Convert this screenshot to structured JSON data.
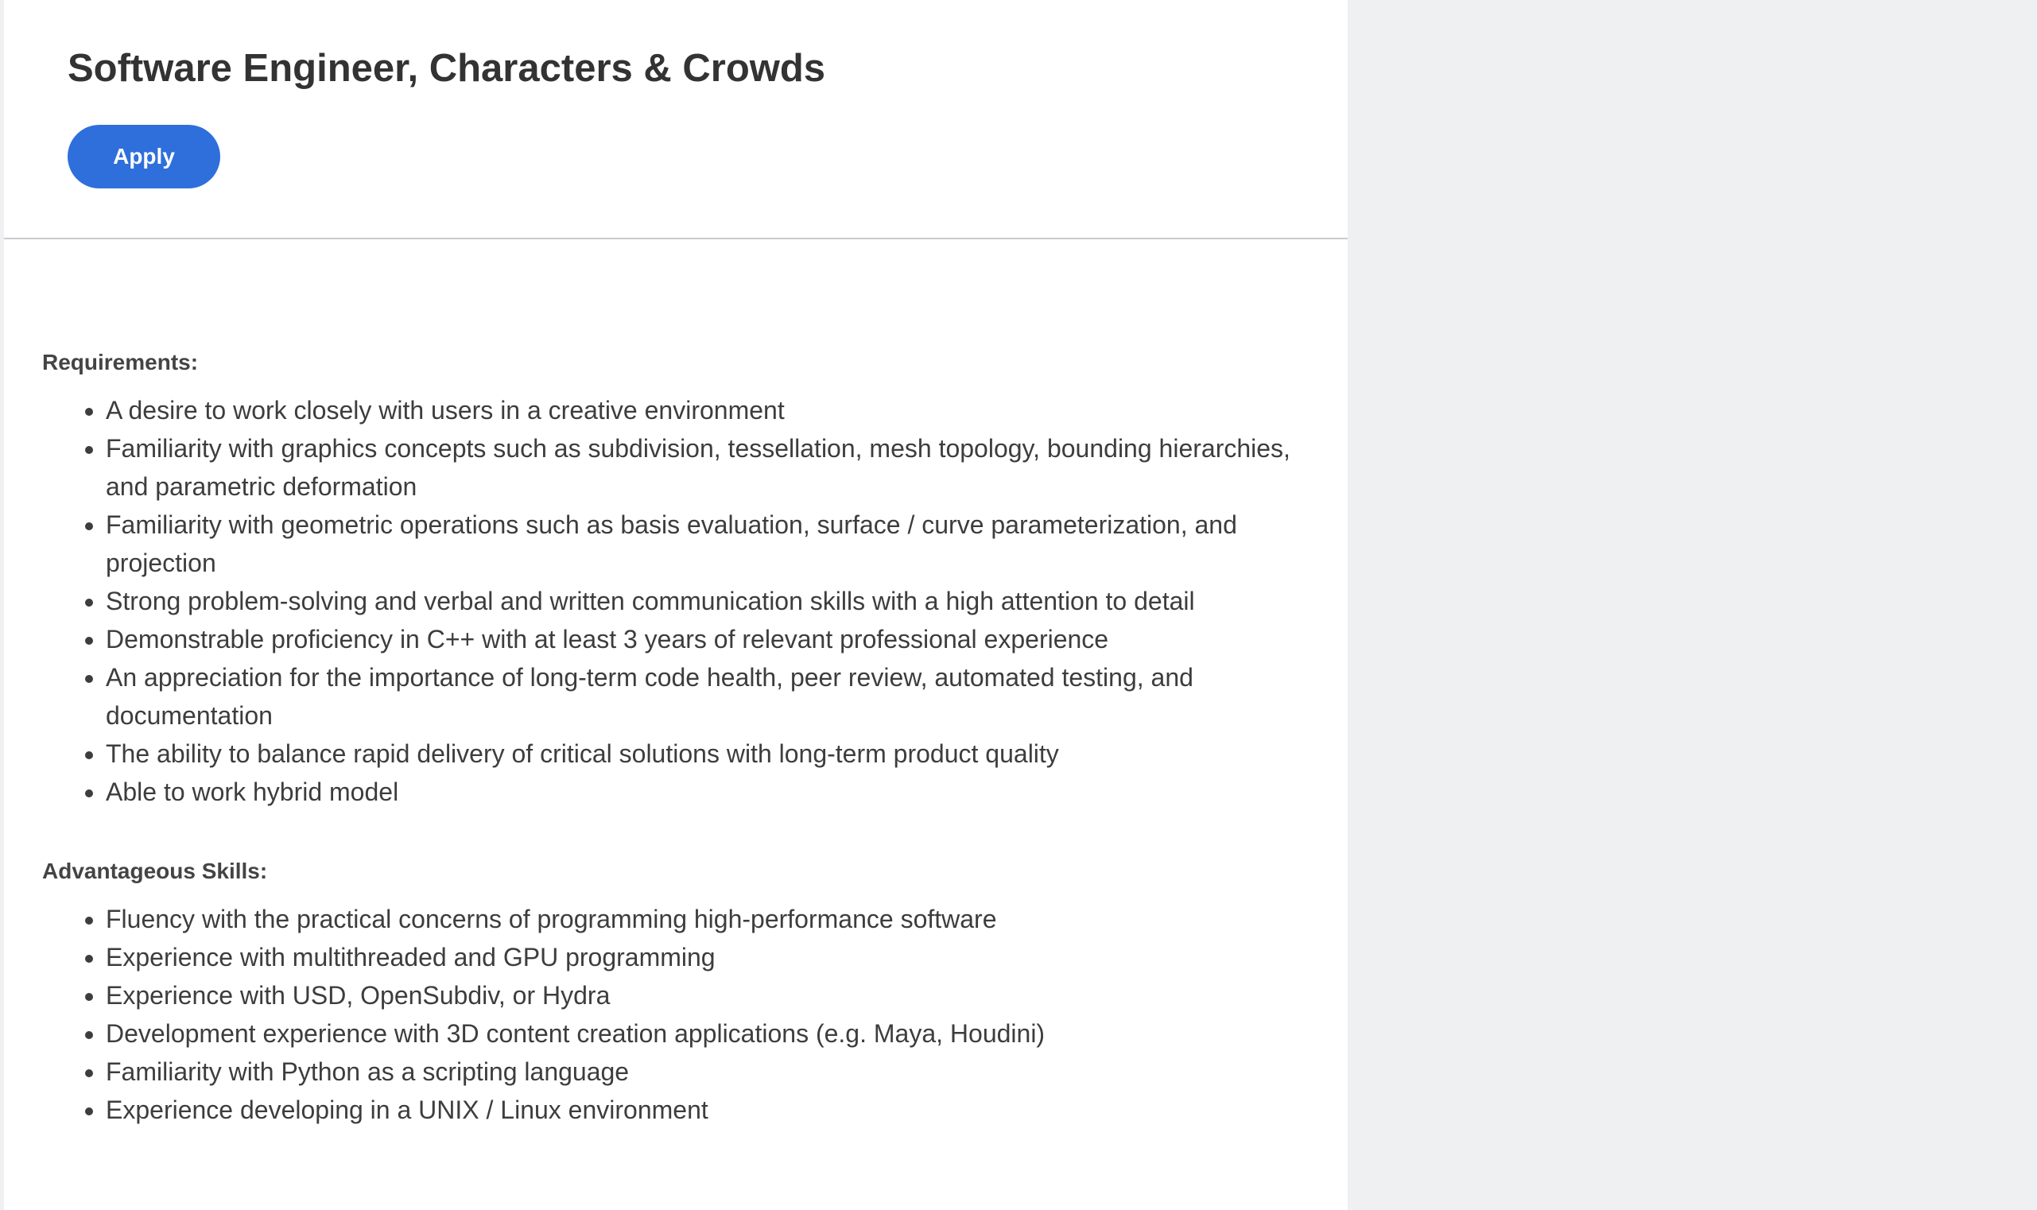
{
  "job": {
    "title": "Software Engineer, Characters & Crowds",
    "apply_label": "Apply"
  },
  "requirements": {
    "heading": "Requirements:",
    "items": [
      "A desire to work closely with users in a creative environment",
      "Familiarity with graphics concepts such as subdivision, tessellation, mesh topology, bounding hierarchies, and parametric deformation",
      "Familiarity with geometric operations such as basis evaluation, surface / curve parameterization, and projection",
      "Strong problem-solving and verbal and written communication skills with a high attention to detail",
      "Demonstrable proficiency in C++ with at least 3 years of relevant professional experience",
      "An appreciation for the importance of long-term code health, peer review, automated testing, and documentation",
      "The ability to balance rapid delivery of critical solutions with long-term product quality",
      "Able to work hybrid model"
    ]
  },
  "advantageous": {
    "heading": "Advantageous Skills:",
    "items": [
      "Fluency with the practical concerns of programming high-performance software",
      "Experience with multithreaded and GPU programming",
      "Experience with USD, OpenSubdiv, or Hydra",
      "Development experience with 3D content creation applications (e.g. Maya, Houdini)",
      "Familiarity with Python as a scripting language",
      "Experience developing in a UNIX / Linux environment"
    ]
  },
  "colors": {
    "accent": "#2f6fdb",
    "background": "#eff0f2",
    "panel": "#ffffff",
    "text": "#3d3d3d"
  }
}
